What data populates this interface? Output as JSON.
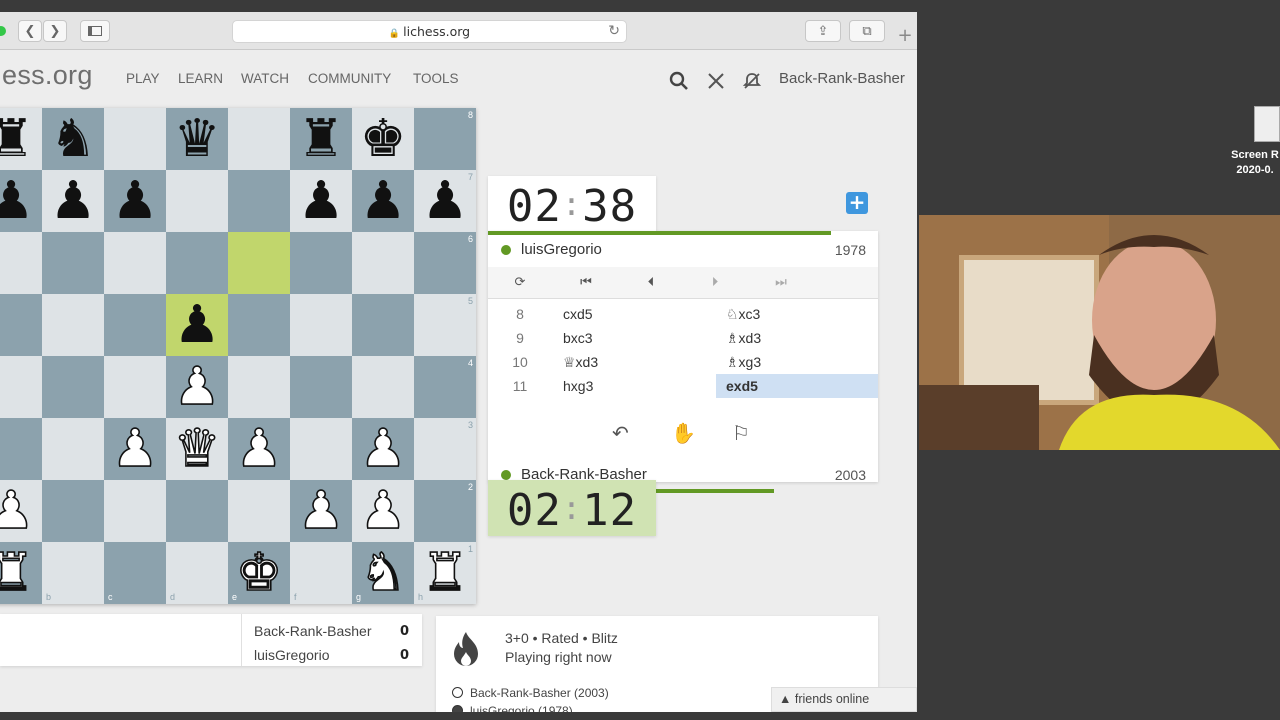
{
  "browser": {
    "url": "lichess.org"
  },
  "site": {
    "logo": "ess.org",
    "nav": [
      "PLAY",
      "LEARN",
      "WATCH",
      "COMMUNITY",
      "TOOLS"
    ],
    "username": "Back-Rank-Basher"
  },
  "board": {
    "pieces": [
      {
        "sq": "a8",
        "p": "♜",
        "c": "b"
      },
      {
        "sq": "b8",
        "p": "♞",
        "c": "b"
      },
      {
        "sq": "d8",
        "p": "♛",
        "c": "b"
      },
      {
        "sq": "f8",
        "p": "♜",
        "c": "b"
      },
      {
        "sq": "g8",
        "p": "♚",
        "c": "b"
      },
      {
        "sq": "a7",
        "p": "♟",
        "c": "b"
      },
      {
        "sq": "b7",
        "p": "♟",
        "c": "b"
      },
      {
        "sq": "c7",
        "p": "♟",
        "c": "b"
      },
      {
        "sq": "f7",
        "p": "♟",
        "c": "b"
      },
      {
        "sq": "g7",
        "p": "♟",
        "c": "b"
      },
      {
        "sq": "h7",
        "p": "♟",
        "c": "b"
      },
      {
        "sq": "d5",
        "p": "♟",
        "c": "b"
      },
      {
        "sq": "d4",
        "p": "♟",
        "c": "w"
      },
      {
        "sq": "c3",
        "p": "♟",
        "c": "w"
      },
      {
        "sq": "d3",
        "p": "♛",
        "c": "w"
      },
      {
        "sq": "e3",
        "p": "♟",
        "c": "w"
      },
      {
        "sq": "g3",
        "p": "♟",
        "c": "w"
      },
      {
        "sq": "a2",
        "p": "♟",
        "c": "w"
      },
      {
        "sq": "f2",
        "p": "♟",
        "c": "w"
      },
      {
        "sq": "g2",
        "p": "♟",
        "c": "w"
      },
      {
        "sq": "a1",
        "p": "♜",
        "c": "w"
      },
      {
        "sq": "e1",
        "p": "♚",
        "c": "w"
      },
      {
        "sq": "g1",
        "p": "♞",
        "c": "w"
      },
      {
        "sq": "h1",
        "p": "♜",
        "c": "w"
      }
    ],
    "highlight": [
      "e6",
      "d5"
    ],
    "files": [
      "a",
      "b",
      "c",
      "d",
      "e",
      "f",
      "g",
      "h"
    ],
    "ranks": [
      "8",
      "7",
      "6",
      "5",
      "4",
      "3",
      "2",
      "1"
    ]
  },
  "clocks": {
    "top": {
      "min": "02",
      "sec": "38"
    },
    "bottom": {
      "min": "02",
      "sec": "12"
    }
  },
  "players": {
    "top": {
      "name": "luisGregorio",
      "rating": "1978"
    },
    "bottom": {
      "name": "Back-Rank-Basher",
      "rating": "2003"
    }
  },
  "moves": [
    {
      "no": "8",
      "white": "cxd5",
      "black": "♘xc3"
    },
    {
      "no": "9",
      "white": "bxc3",
      "black": "♗xd3"
    },
    {
      "no": "10",
      "white": "♕xd3",
      "black": "♗xg3"
    },
    {
      "no": "11",
      "white": "hxg3",
      "black": "exd5"
    }
  ],
  "controls": {
    "flip": "⟳",
    "first": "⏮",
    "prev": "⏴",
    "next": "⏵",
    "last": "⏭"
  },
  "actions": {
    "takeback": "↶",
    "draw": "✋",
    "resign": "⚐"
  },
  "crosstable": [
    {
      "name": "Back-Rank-Basher",
      "score": "0"
    },
    {
      "name": "luisGregorio",
      "score": "0"
    }
  ],
  "game": {
    "mode": "3+0 • Rated • Blitz",
    "status": "Playing right now",
    "white": "Back-Rank-Basher (2003)",
    "black": "luisGregorio (1978)"
  },
  "friends": "▲ friends online",
  "desktop": {
    "label": "Screen R\n2020-0."
  }
}
